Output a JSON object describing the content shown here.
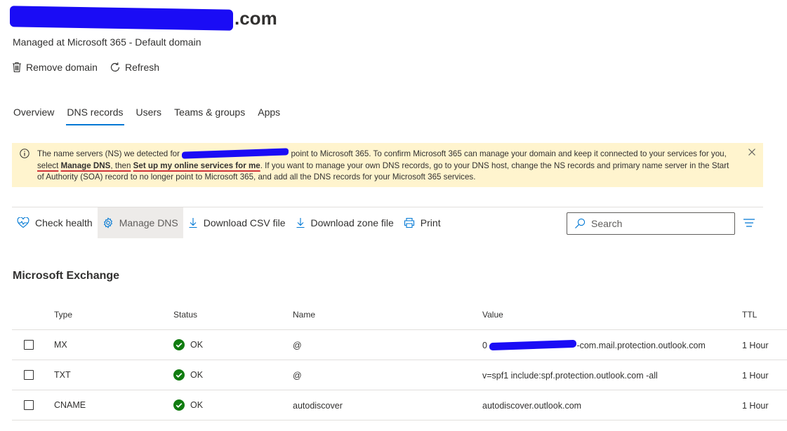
{
  "header": {
    "title_suffix": ".com",
    "subtitle": "Managed at Microsoft 365 - Default domain"
  },
  "actions": {
    "remove_domain": "Remove domain",
    "refresh": "Refresh"
  },
  "tabs": [
    {
      "label": "Overview",
      "active": false
    },
    {
      "label": "DNS records",
      "active": true
    },
    {
      "label": "Users",
      "active": false
    },
    {
      "label": "Teams & groups",
      "active": false
    },
    {
      "label": "Apps",
      "active": false
    }
  ],
  "banner": {
    "text_1": "The name servers (NS) we detected for",
    "text_2": "point to Microsoft 365. To confirm Microsoft 365 can manage your domain and keep it connected to your services for you,",
    "text_select": "select",
    "text_manage_dns": "Manage DNS",
    "text_then": ", then",
    "text_setup": "Set up my online services for me",
    "text_3": ". If you want to manage your own DNS records, go to your DNS host, change the NS records and primary name server in the Start of Authority (SOA) record to no longer point to Microsoft 365, and add all the DNS records for your Microsoft 365 services.",
    "bg_color": "#fff4ce"
  },
  "toolbar": {
    "check_health": "Check health",
    "manage_dns": "Manage DNS",
    "download_csv": "Download CSV file",
    "download_zone": "Download zone file",
    "print": "Print",
    "search_placeholder": "Search"
  },
  "section": {
    "title": "Microsoft Exchange"
  },
  "table": {
    "columns": [
      "Type",
      "Status",
      "Name",
      "Value",
      "TTL"
    ],
    "rows": [
      {
        "type": "MX",
        "status": "OK",
        "name": "@",
        "value_prefix": "0",
        "value": "-com.mail.protection.outlook.com",
        "ttl": "1 Hour"
      },
      {
        "type": "TXT",
        "status": "OK",
        "name": "@",
        "value_prefix": "",
        "value": "v=spf1 include:spf.protection.outlook.com -all",
        "ttl": "1 Hour"
      },
      {
        "type": "CNAME",
        "status": "OK",
        "name": "autodiscover",
        "value_prefix": "",
        "value": "autodiscover.outlook.com",
        "ttl": "1 Hour"
      }
    ]
  },
  "colors": {
    "accent": "#0078d4",
    "ok_green": "#107c10",
    "redaction": "#1a0cf5"
  }
}
